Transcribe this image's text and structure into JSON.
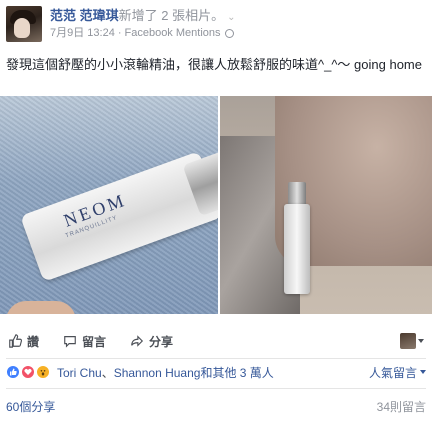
{
  "header": {
    "author": "范范 范瑋琪",
    "action": "新增了 2 張相片。",
    "date": "7月9日 13:24",
    "separator": "·",
    "source": "Facebook Mentions"
  },
  "post": {
    "text": "發現這個舒壓的小小滾輪精油，很讓人放鬆舒服的味道^_^～ going home"
  },
  "photos": {
    "left_brand": "NEOM",
    "left_subbrand": "TRANQUILLITY"
  },
  "actions": {
    "like": "讚",
    "comment": "留言",
    "share": "分享"
  },
  "reactions": {
    "name1": "Tori Chu",
    "joiner": "、",
    "name2": "Shannon Huang",
    "others": "和其他 3 萬人",
    "top_comments": "人氣留言"
  },
  "footer": {
    "shares": "60個分享",
    "comments": "34則留言"
  },
  "colors": {
    "link": "#365899",
    "like": "#4080ff",
    "love": "#f25268",
    "wow": "#f7b125"
  }
}
